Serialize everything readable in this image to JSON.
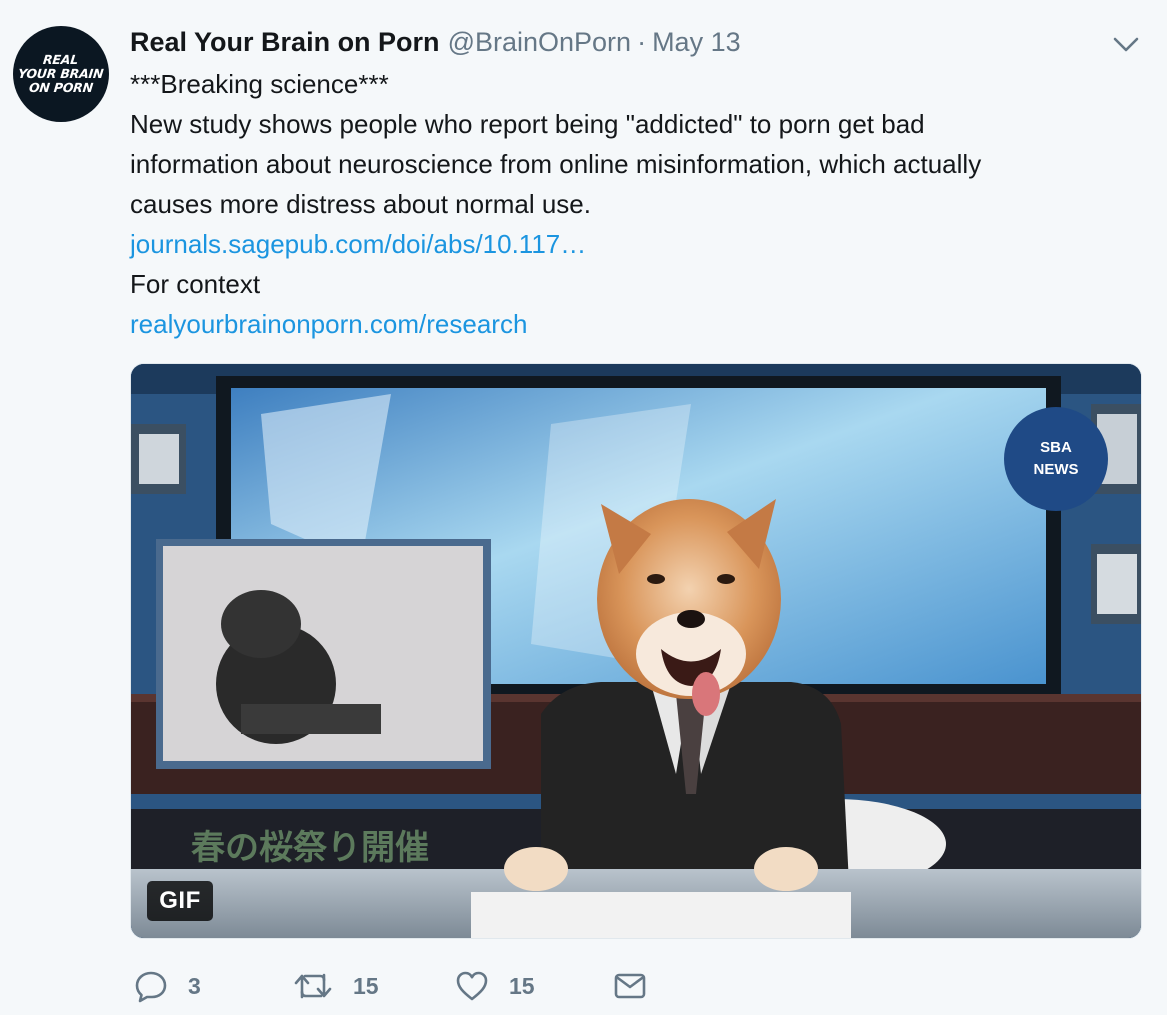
{
  "account": {
    "display_name": "Real Your Brain on Porn",
    "handle": "@BrainOnPorn",
    "separator": "·",
    "date": "May 13",
    "avatar_lines": [
      "REAL",
      "YOUR BRAIN",
      "ON PORN"
    ]
  },
  "tweet": {
    "lines": [
      "***Breaking science***",
      "New study shows people who report being \"addicted\" to porn get bad",
      "information about neuroscience from online misinformation, which actually",
      "causes more distress about normal use."
    ],
    "link1": "journals.sagepub.com/doi/abs/10.117…",
    "context": "For context",
    "link2": "realyourbrainonporn.com/research"
  },
  "media": {
    "badge": "GIF",
    "caption_overlay": "春の桜祭り開催",
    "logo_text": [
      "SBA",
      "NEWS"
    ]
  },
  "actions": {
    "reply_count": "3",
    "retweet_count": "15",
    "like_count": "15"
  },
  "colors": {
    "background": "#f5f8fa",
    "link": "#1b95e0",
    "secondary": "#657786"
  },
  "icons": [
    "chevron-down-icon",
    "reply-icon",
    "retweet-icon",
    "like-icon",
    "message-icon"
  ]
}
